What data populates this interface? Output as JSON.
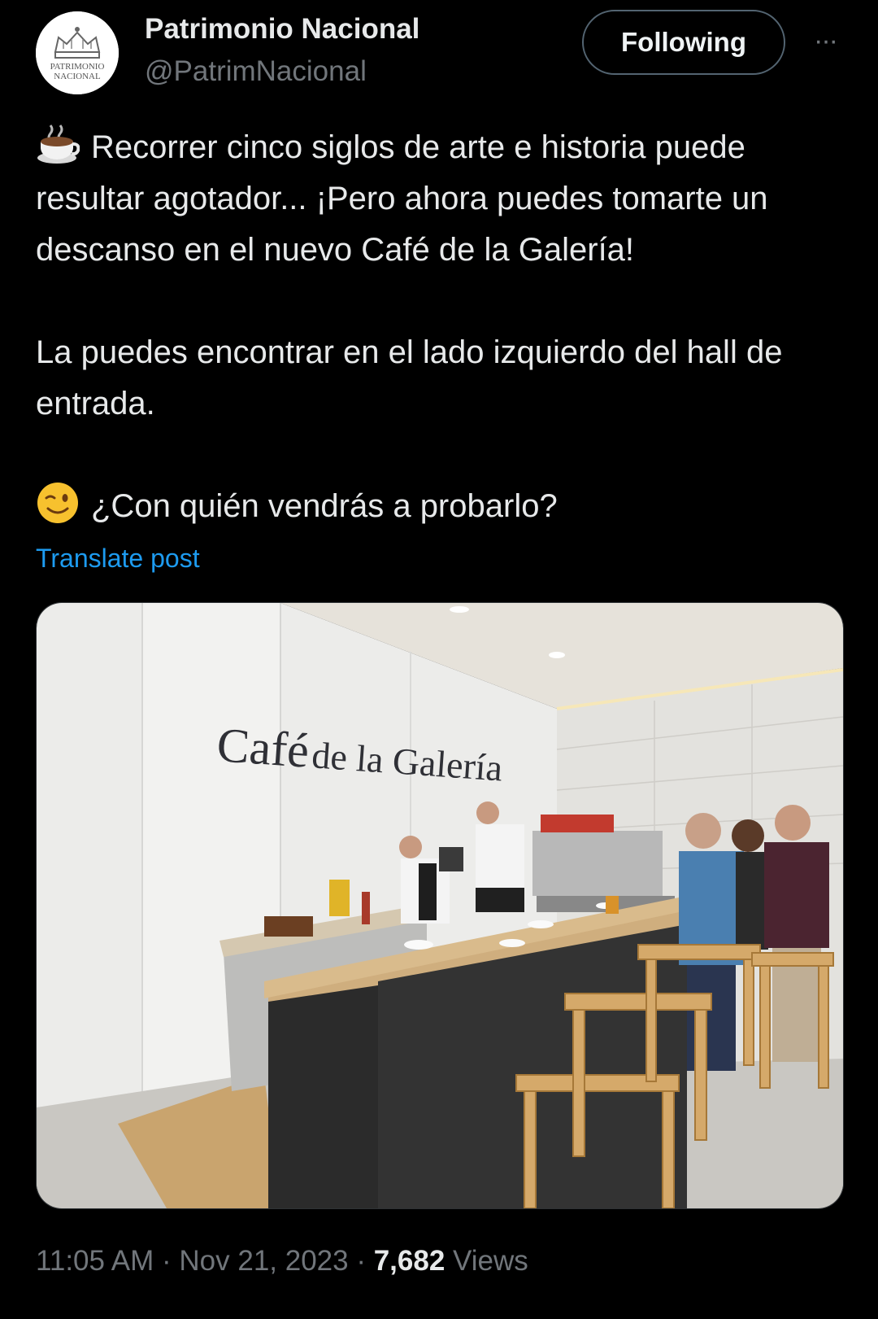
{
  "account": {
    "name": "Patrimonio Nacional",
    "handle": "@PatrimNacional",
    "avatar_text_line1": "PATRIMONIO",
    "avatar_text_line2": "NACIONAL",
    "avatar_icon": "crown-icon"
  },
  "actions": {
    "follow_label": "Following",
    "more_icon": "more-dots-icon",
    "more_label": "···"
  },
  "post": {
    "paragraph1_emoji": "hot-beverage-emoji",
    "paragraph1": "Recorrer cinco siglos de arte e historia puede resultar agotador... ¡Pero ahora puedes tomarte un descanso en el nuevo Café de la Galería!",
    "paragraph2": "La puedes encontrar en el lado izquierdo del hall de entrada.",
    "paragraph3_emoji": "winking-face-emoji",
    "paragraph3": "¿Con quién vendrás a probarlo?",
    "translate_label": "Translate post"
  },
  "media": {
    "sign_part1": "Café",
    "sign_part2": "de la Galería"
  },
  "meta": {
    "time": "11:05 AM",
    "separator": " · ",
    "date": "Nov 21, 2023",
    "views_count": "7,682",
    "views_label": "Views"
  },
  "colors": {
    "background": "#000000",
    "text": "#e7e9ea",
    "secondary": "#71767b",
    "link": "#1d9bf0"
  }
}
